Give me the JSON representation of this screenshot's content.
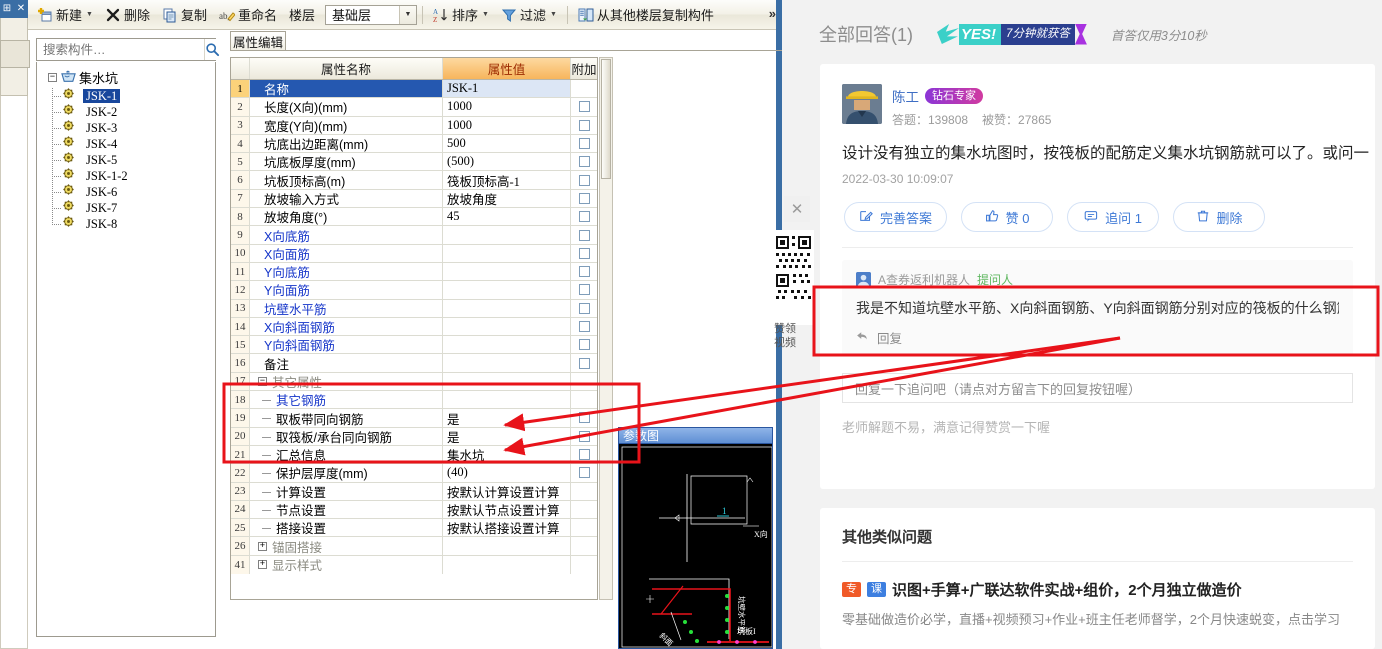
{
  "app": {
    "toolbar": {
      "items": [
        {
          "label": "新建",
          "icon": "new-icon",
          "caret": true
        },
        {
          "label": "删除",
          "icon": "delete-x-icon",
          "caret": false
        },
        {
          "label": "复制",
          "icon": "copy-icon",
          "caret": false
        },
        {
          "label": "重命名",
          "icon": "rename-icon",
          "caret": false
        }
      ],
      "floor_label": "楼层",
      "floor_value": "基础层",
      "sort_label": "排序",
      "filter_label": "过滤",
      "copy_from_floor_label": "从其他楼层复制构件",
      "overflow": "»",
      "pin": "⊞",
      "close": "✕"
    },
    "search": {
      "placeholder": "搜索构件…",
      "value": "",
      "icon": "search-icon"
    },
    "tree": {
      "root": {
        "label": "集水坑",
        "icon": "sump-pit-icon",
        "expanded": true
      },
      "nodes": [
        {
          "label": "JSK-1",
          "selected": true
        },
        {
          "label": "JSK-2",
          "selected": false
        },
        {
          "label": "JSK-3",
          "selected": false
        },
        {
          "label": "JSK-4",
          "selected": false
        },
        {
          "label": "JSK-5",
          "selected": false
        },
        {
          "label": "JSK-1-2",
          "selected": false
        },
        {
          "label": "JSK-6",
          "selected": false
        },
        {
          "label": "JSK-7",
          "selected": false
        },
        {
          "label": "JSK-8",
          "selected": false
        }
      ]
    },
    "property_panel": {
      "tab_label": "属性编辑",
      "columns": {
        "index": "",
        "name": "属性名称",
        "value": "属性值",
        "extra": "附加"
      },
      "rows": [
        {
          "n": "1",
          "name": "名称",
          "value": "JSK-1",
          "checkbox": false,
          "selected": true,
          "indent": 1,
          "style": "plain"
        },
        {
          "n": "2",
          "name": "长度(X向)(mm)",
          "value": "1000",
          "checkbox": true,
          "indent": 1,
          "style": "plain"
        },
        {
          "n": "3",
          "name": "宽度(Y向)(mm)",
          "value": "1000",
          "checkbox": true,
          "indent": 1,
          "style": "plain"
        },
        {
          "n": "4",
          "name": "坑底出边距离(mm)",
          "value": "500",
          "checkbox": true,
          "indent": 1,
          "style": "plain"
        },
        {
          "n": "5",
          "name": "坑底板厚度(mm)",
          "value": "(500)",
          "checkbox": true,
          "indent": 1,
          "style": "plain"
        },
        {
          "n": "6",
          "name": "坑板顶标高(m)",
          "value": "筏板顶标高-1",
          "checkbox": true,
          "indent": 1,
          "style": "plain"
        },
        {
          "n": "7",
          "name": "放坡输入方式",
          "value": "放坡角度",
          "checkbox": true,
          "indent": 1,
          "style": "plain"
        },
        {
          "n": "8",
          "name": "放坡角度(°)",
          "value": "45",
          "checkbox": true,
          "indent": 1,
          "style": "plain"
        },
        {
          "n": "9",
          "name": "X向底筋",
          "value": "",
          "checkbox": true,
          "indent": 1,
          "style": "link"
        },
        {
          "n": "10",
          "name": "X向面筋",
          "value": "",
          "checkbox": true,
          "indent": 1,
          "style": "link"
        },
        {
          "n": "11",
          "name": "Y向底筋",
          "value": "",
          "checkbox": true,
          "indent": 1,
          "style": "link"
        },
        {
          "n": "12",
          "name": "Y向面筋",
          "value": "",
          "checkbox": true,
          "indent": 1,
          "style": "link"
        },
        {
          "n": "13",
          "name": "坑壁水平筋",
          "value": "",
          "checkbox": true,
          "indent": 1,
          "style": "link"
        },
        {
          "n": "14",
          "name": "X向斜面钢筋",
          "value": "",
          "checkbox": true,
          "indent": 1,
          "style": "link"
        },
        {
          "n": "15",
          "name": "Y向斜面钢筋",
          "value": "",
          "checkbox": true,
          "indent": 1,
          "style": "link"
        },
        {
          "n": "16",
          "name": "备注",
          "value": "",
          "checkbox": true,
          "indent": 1,
          "style": "plain"
        },
        {
          "n": "17",
          "name": "其它属性",
          "value": "",
          "checkbox": false,
          "indent": 0,
          "style": "group",
          "expander": "−"
        },
        {
          "n": "18",
          "name": "其它钢筋",
          "value": "",
          "checkbox": false,
          "indent": 2,
          "style": "link-dash"
        },
        {
          "n": "19",
          "name": "取板带同向钢筋",
          "value": "是",
          "checkbox": true,
          "indent": 2,
          "style": "dash"
        },
        {
          "n": "20",
          "name": "取筏板/承台同向钢筋",
          "value": "是",
          "checkbox": true,
          "indent": 2,
          "style": "dash"
        },
        {
          "n": "21",
          "name": "汇总信息",
          "value": "集水坑",
          "checkbox": true,
          "indent": 2,
          "style": "dash"
        },
        {
          "n": "22",
          "name": "保护层厚度(mm)",
          "value": "(40)",
          "checkbox": true,
          "indent": 2,
          "style": "dash"
        },
        {
          "n": "23",
          "name": "计算设置",
          "value": "按默认计算设置计算",
          "checkbox": false,
          "indent": 2,
          "style": "dash"
        },
        {
          "n": "24",
          "name": "节点设置",
          "value": "按默认节点设置计算",
          "checkbox": false,
          "indent": 2,
          "style": "dash"
        },
        {
          "n": "25",
          "name": "搭接设置",
          "value": "按默认搭接设置计算",
          "checkbox": false,
          "indent": 2,
          "style": "dash"
        },
        {
          "n": "26",
          "name": "锚固搭接",
          "value": "",
          "checkbox": false,
          "indent": 0,
          "style": "group",
          "expander": "+"
        },
        {
          "n": "41",
          "name": "显示样式",
          "value": "",
          "checkbox": false,
          "indent": 0,
          "style": "group",
          "expander": "+"
        }
      ]
    },
    "cad_preview": {
      "title": "参数图",
      "labels": {
        "dim_1": "1",
        "x_dir": "X向",
        "wall_horiz": "坑壁水平筋",
        "pit_slab": "坑板I",
        "slope": "斜面"
      }
    }
  },
  "web": {
    "header": {
      "all_answers": "全部回答(1)",
      "badge": {
        "mark": "7",
        "yes": "YES!",
        "tagline": "7分钟就获答"
      },
      "first_answer_time": "首答仅用3分10秒"
    },
    "answer": {
      "user_name": "陈工",
      "user_tag": "钻石专家",
      "stat_answers": "答题：139808",
      "stat_likes": "被赞：27865",
      "body": "设计没有独立的集水坑图时，按筏板的配筋定义集水坑钢筋就可以了。或问一",
      "time": "2022-03-30 10:09:07",
      "actions": [
        {
          "label": "完善答案",
          "icon": "edit-icon"
        },
        {
          "label": "赞 0",
          "icon": "thumbs-up-icon"
        },
        {
          "label": "追问 1",
          "icon": "comment-icon"
        },
        {
          "label": "删除",
          "icon": "trash-icon"
        }
      ]
    },
    "followup": {
      "user_name": "A查券返利机器人",
      "asker_tag": "提问人",
      "text": "我是不知道坑壁水平筋、X向斜面钢筋、Y向斜面钢筋分别对应的筏板的什么钢筋呢",
      "reply_label": "回复",
      "reply_icon": "reply-arrow-icon"
    },
    "reply_box": {
      "placeholder": "回复一下追问吧（请点对方留言下的回复按钮喔）",
      "value": ""
    },
    "tip": "老师解题不易，满意记得赞赏一下喔",
    "similar": {
      "title": "其他类似问题",
      "items": [
        {
          "tag1": "专",
          "tag2": "课",
          "headline": "识图+手算+广联达软件实战+组价，2个月独立做造价",
          "sub": "零基础做造价必学，直播+视频预习+作业+班主任老师督学，2个月快速蜕变，点击学习"
        }
      ]
    },
    "qr_widget": {
      "close_icon": "close-icon",
      "qr_icon": "qr-code-icon",
      "text_line1": "赞领",
      "text_line2": "视频"
    }
  },
  "annotations": {
    "color": "#e8131a",
    "box_grid_label": "红框-属性行19-20",
    "box_followup_label": "红框-追问内容",
    "arrows": 2
  }
}
